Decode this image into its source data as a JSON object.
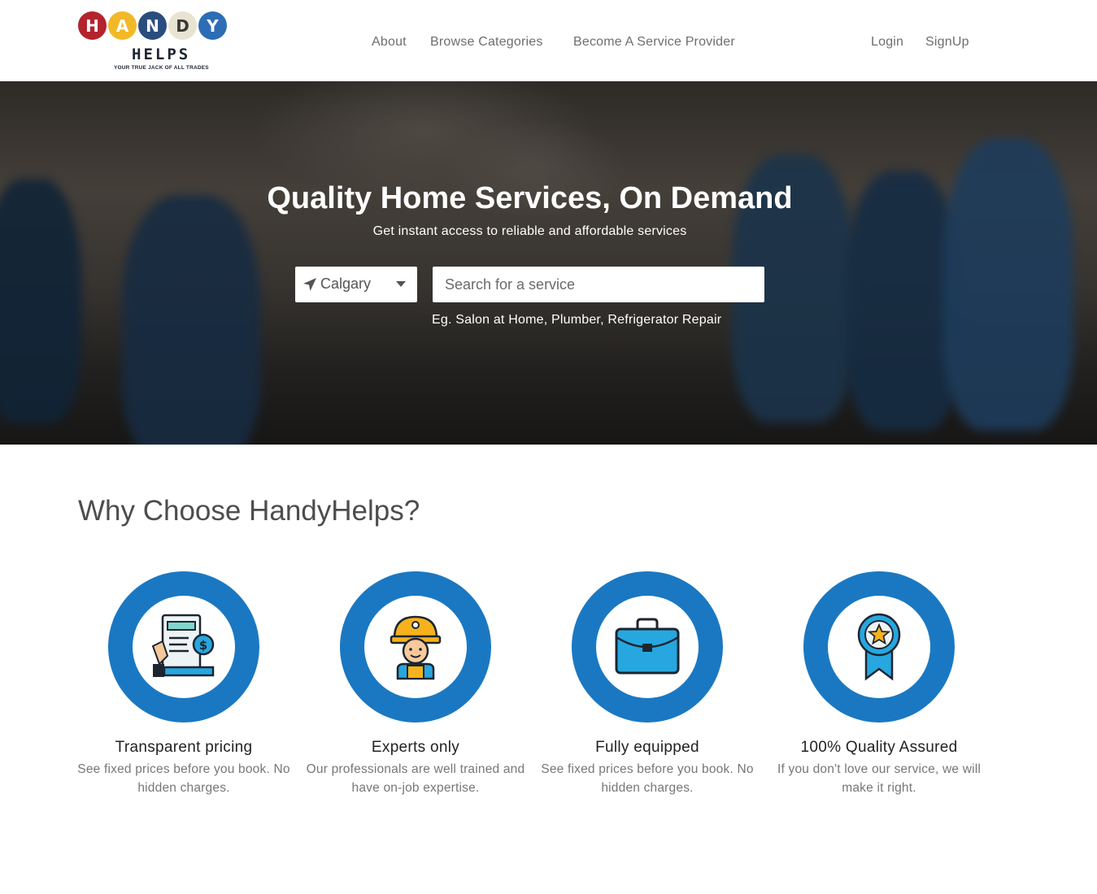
{
  "brand": {
    "logo_letters": [
      "H",
      "A",
      "N",
      "D",
      "Y"
    ],
    "logo_colors": [
      "#b3242c",
      "#f1b928",
      "#2a4d7e",
      "#e9e3d2",
      "#2d6db5"
    ],
    "logo_word": "HELPS",
    "tagline": "YOUR TRUE JACK OF ALL TRADES"
  },
  "nav": {
    "about": "About",
    "browse": "Browse Categories",
    "become_provider": "Become A Service Provider",
    "login": "Login",
    "signup": "SignUp"
  },
  "hero": {
    "title": "Quality Home Services, On Demand",
    "subtitle": "Get instant access to reliable and affordable services",
    "city": "Calgary",
    "search_placeholder": "Search for a service",
    "example": "Eg. Salon at Home, Plumber, Refrigerator Repair"
  },
  "why": {
    "title": "Why Choose HandyHelps?",
    "features": [
      {
        "icon": "invoice-icon",
        "title": "Transparent pricing",
        "desc": "See fixed prices before you book. No hidden charges."
      },
      {
        "icon": "worker-icon",
        "title": "Experts only",
        "desc": "Our professionals are well trained and have on-job expertise."
      },
      {
        "icon": "briefcase-icon",
        "title": "Fully equipped",
        "desc": "See fixed prices before you book. No hidden charges."
      },
      {
        "icon": "award-ribbon-icon",
        "title": "100% Quality Assured",
        "desc": "If you don't love our service, we will make it right."
      }
    ]
  },
  "colors": {
    "accent": "#1a78c2",
    "text_dark": "#222222",
    "text_muted": "#777777"
  }
}
